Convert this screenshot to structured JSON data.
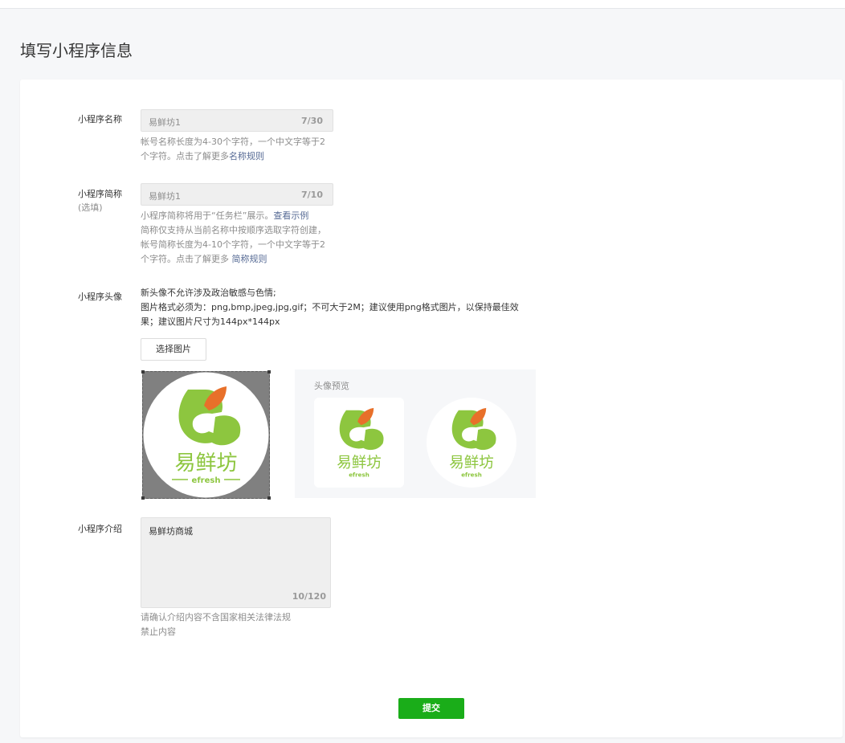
{
  "page_title": "填写小程序信息",
  "name_field": {
    "label": "小程序名称",
    "value": "易鲜坊1",
    "counter": "7/30",
    "hint_prefix": "帐号名称长度为4-30个字符，一个中文字等于2个字符。点击了解更多",
    "hint_link": "名称规则"
  },
  "short_name_field": {
    "label": "小程序简称",
    "label_sub": "(选填)",
    "value": "易鲜坊1",
    "counter": "7/10",
    "hint_line1_prefix": "小程序简称将用于“任务栏”展示。",
    "hint_line1_link": "查看示例",
    "hint_rest_prefix": "简称仅支持从当前名称中按顺序选取字符创建，帐号简称长度为4-10个字符，一个中文字等于2个字符。点击了解更多 ",
    "hint_link": "简称规则"
  },
  "avatar": {
    "label": "小程序头像",
    "line1": "新头像不允许涉及政治敏感与色情;",
    "line2": "图片格式必须为：png,bmp,jpeg,jpg,gif；不可大于2M；建议使用png格式图片，以保持最佳效果；建议图片尺寸为144px*144px",
    "choose_button": "选择图片",
    "preview_title": "头像预览",
    "logo_text": "易鲜坊",
    "logo_sub": "efresh",
    "colors": {
      "green": "#8dc63f",
      "orange": "#e8702a"
    }
  },
  "intro": {
    "label": "小程序介绍",
    "value": "易鲜坊商城",
    "counter": "10/120",
    "hint_line1": "请确认介绍内容不含国家相关法律法规",
    "hint_line2": "禁止内容"
  },
  "submit_button": "提交",
  "colors": {
    "primary": "#1aad19",
    "link": "#576b95"
  }
}
